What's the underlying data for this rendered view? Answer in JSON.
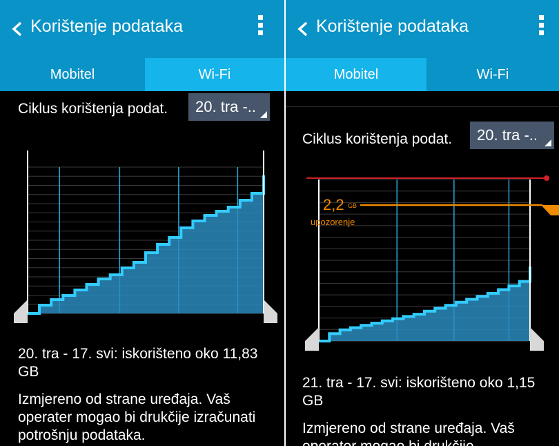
{
  "colors": {
    "accent": "#0a93c6",
    "active_tab": "#15b4ea",
    "usage_fill": "#2a8bbd",
    "usage_line": "#33ccff",
    "limit_line": "#d3202a",
    "warning_line": "#f08a00",
    "selector_bg": "#47566a"
  },
  "left": {
    "appbar": {
      "back_icon": "chevron-left-icon",
      "title": "Korištenje podataka",
      "menu_icon": "more-vertical-icon"
    },
    "tabs": [
      {
        "label": "Mobitel",
        "active": false
      },
      {
        "label": "Wi-Fi",
        "active": true
      }
    ],
    "cycle": {
      "label": "Ciklus korištenja podat.",
      "value": "20. tra -.."
    },
    "summary": "20. tra - 17. svi: iskorišteno oko 11,83 GB",
    "note": "Izmjereno od strane uređaja. Vaš operater mogao bi drukčije izračunati potrošnju podataka."
  },
  "right": {
    "appbar": {
      "back_icon": "chevron-left-icon",
      "title": "Korištenje podataka",
      "menu_icon": "more-vertical-icon"
    },
    "tabs": [
      {
        "label": "Mobitel",
        "active": true
      },
      {
        "label": "Wi-Fi",
        "active": false
      }
    ],
    "cycle": {
      "label": "Ciklus korištenja podat.",
      "value": "20. tra -.."
    },
    "warning": {
      "value": "2,2",
      "unit": "GB",
      "label": "upozorenje"
    },
    "summary": "21. tra - 17. svi: iskorišteno oko 1,15 GB",
    "note": "Izmjereno od strane uređaja. Vaš operater mogao bi drukčije"
  },
  "chart_data": [
    {
      "type": "area",
      "title": "Wi-Fi",
      "x": [
        0,
        0.05,
        0.1,
        0.15,
        0.2,
        0.25,
        0.3,
        0.35,
        0.4,
        0.45,
        0.5,
        0.55,
        0.6,
        0.65,
        0.7,
        0.75,
        0.8,
        0.85,
        0.9,
        0.95,
        1.0
      ],
      "values": [
        0,
        0.06,
        0.1,
        0.13,
        0.17,
        0.21,
        0.25,
        0.28,
        0.33,
        0.37,
        0.44,
        0.5,
        0.55,
        0.62,
        0.67,
        0.71,
        0.74,
        0.77,
        0.82,
        0.87,
        1.0
      ],
      "ylim": [
        0,
        1.0
      ],
      "grid": true
    },
    {
      "type": "area",
      "title": "Mobitel",
      "x": [
        0,
        0.05,
        0.1,
        0.15,
        0.2,
        0.25,
        0.3,
        0.35,
        0.4,
        0.45,
        0.5,
        0.55,
        0.6,
        0.65,
        0.7,
        0.75,
        0.8,
        0.85,
        0.9,
        0.95,
        1.0
      ],
      "values": [
        0,
        0.1,
        0.15,
        0.18,
        0.21,
        0.24,
        0.27,
        0.3,
        0.33,
        0.36,
        0.4,
        0.44,
        0.48,
        0.52,
        0.56,
        0.6,
        0.64,
        0.69,
        0.74,
        0.8,
        1.0
      ],
      "ylim": [
        0,
        1.0
      ],
      "grid": true
    }
  ]
}
